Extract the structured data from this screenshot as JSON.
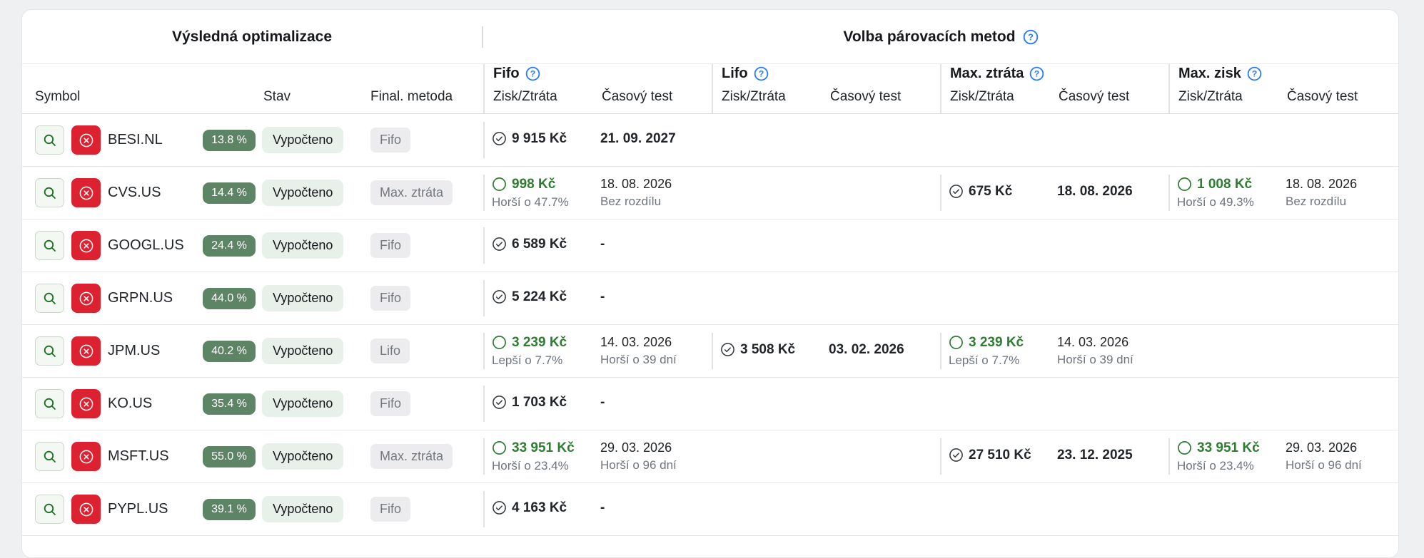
{
  "titles": {
    "left": "Výsledná optimalizace",
    "right": "Volba párovacích metod"
  },
  "columns": {
    "symbol": "Symbol",
    "stav": "Stav",
    "metoda": "Final. metoda",
    "zisk": "Zisk/Ztráta",
    "cas": "Časový test"
  },
  "groups": [
    {
      "key": "fifo",
      "label": "Fifo"
    },
    {
      "key": "lifo",
      "label": "Lifo"
    },
    {
      "key": "max_ztrata",
      "label": "Max. ztráta"
    },
    {
      "key": "max_zisk",
      "label": "Max. zisk"
    }
  ],
  "icons": {
    "search": "search-icon",
    "delete": "circle-x-icon",
    "selected": "check-circle-icon",
    "alternative": "empty-circle-icon",
    "help": "question-circle-icon"
  },
  "colors": {
    "percent_badge": "#5d8465",
    "status_badge_bg": "#e8f0ea",
    "method_badge_bg": "#ececee",
    "delete_button": "#dc2130",
    "green_value": "#2e7d32",
    "dark_value": "#212529",
    "muted_text": "#6d757d",
    "help_blue": "#2b7bf3"
  },
  "rows": [
    {
      "symbol": "BESI.NL",
      "percent": "13.8 %",
      "stav": "Vypočteno",
      "metoda": "Fifo",
      "methods": {
        "fifo": {
          "icon": "check",
          "value": "9 915 Kč",
          "green": false,
          "sub": "",
          "date": "21. 09. 2027",
          "date_bold": true,
          "date_sub": ""
        },
        "lifo": null,
        "max_ztrata": null,
        "max_zisk": null
      }
    },
    {
      "symbol": "CVS.US",
      "percent": "14.4 %",
      "stav": "Vypočteno",
      "metoda": "Max. ztráta",
      "methods": {
        "fifo": {
          "icon": "circle",
          "value": "998 Kč",
          "green": true,
          "sub": "Horší o 47.7%",
          "date": "18. 08. 2026",
          "date_bold": false,
          "date_sub": "Bez rozdílu"
        },
        "lifo": null,
        "max_ztrata": {
          "icon": "check",
          "value": "675 Kč",
          "green": false,
          "sub": "",
          "date": "18. 08. 2026",
          "date_bold": true,
          "date_sub": ""
        },
        "max_zisk": {
          "icon": "circle",
          "value": "1 008 Kč",
          "green": true,
          "sub": "Horší o 49.3%",
          "date": "18. 08. 2026",
          "date_bold": false,
          "date_sub": "Bez rozdílu"
        }
      }
    },
    {
      "symbol": "GOOGL.US",
      "percent": "24.4 %",
      "stav": "Vypočteno",
      "metoda": "Fifo",
      "methods": {
        "fifo": {
          "icon": "check",
          "value": "6 589 Kč",
          "green": false,
          "sub": "",
          "date": "-",
          "date_bold": true,
          "date_sub": ""
        },
        "lifo": null,
        "max_ztrata": null,
        "max_zisk": null
      }
    },
    {
      "symbol": "GRPN.US",
      "percent": "44.0 %",
      "stav": "Vypočteno",
      "metoda": "Fifo",
      "methods": {
        "fifo": {
          "icon": "check",
          "value": "5 224 Kč",
          "green": false,
          "sub": "",
          "date": "-",
          "date_bold": true,
          "date_sub": ""
        },
        "lifo": null,
        "max_ztrata": null,
        "max_zisk": null
      }
    },
    {
      "symbol": "JPM.US",
      "percent": "40.2 %",
      "stav": "Vypočteno",
      "metoda": "Lifo",
      "methods": {
        "fifo": {
          "icon": "circle",
          "value": "3 239 Kč",
          "green": true,
          "sub": "Lepší o 7.7%",
          "date": "14. 03. 2026",
          "date_bold": false,
          "date_sub": "Horší o 39 dní"
        },
        "lifo": {
          "icon": "check",
          "value": "3 508 Kč",
          "green": false,
          "sub": "",
          "date": "03. 02. 2026",
          "date_bold": true,
          "date_sub": ""
        },
        "max_ztrata": {
          "icon": "circle",
          "value": "3 239 Kč",
          "green": true,
          "sub": "Lepší o 7.7%",
          "date": "14. 03. 2026",
          "date_bold": false,
          "date_sub": "Horší o 39 dní"
        },
        "max_zisk": null
      }
    },
    {
      "symbol": "KO.US",
      "percent": "35.4 %",
      "stav": "Vypočteno",
      "metoda": "Fifo",
      "methods": {
        "fifo": {
          "icon": "check",
          "value": "1 703 Kč",
          "green": false,
          "sub": "",
          "date": "-",
          "date_bold": true,
          "date_sub": ""
        },
        "lifo": null,
        "max_ztrata": null,
        "max_zisk": null
      }
    },
    {
      "symbol": "MSFT.US",
      "percent": "55.0 %",
      "stav": "Vypočteno",
      "metoda": "Max. ztráta",
      "methods": {
        "fifo": {
          "icon": "circle",
          "value": "33 951 Kč",
          "green": true,
          "sub": "Horší o 23.4%",
          "date": "29. 03. 2026",
          "date_bold": false,
          "date_sub": "Horší o 96 dní"
        },
        "lifo": null,
        "max_ztrata": {
          "icon": "check",
          "value": "27 510 Kč",
          "green": false,
          "sub": "",
          "date": "23. 12. 2025",
          "date_bold": true,
          "date_sub": ""
        },
        "max_zisk": {
          "icon": "circle",
          "value": "33 951 Kč",
          "green": true,
          "sub": "Horší o 23.4%",
          "date": "29. 03. 2026",
          "date_bold": false,
          "date_sub": "Horší o 96 dní"
        }
      }
    },
    {
      "symbol": "PYPL.US",
      "percent": "39.1 %",
      "stav": "Vypočteno",
      "metoda": "Fifo",
      "methods": {
        "fifo": {
          "icon": "check",
          "value": "4 163 Kč",
          "green": false,
          "sub": "",
          "date": "-",
          "date_bold": true,
          "date_sub": ""
        },
        "lifo": null,
        "max_ztrata": null,
        "max_zisk": null
      }
    }
  ]
}
